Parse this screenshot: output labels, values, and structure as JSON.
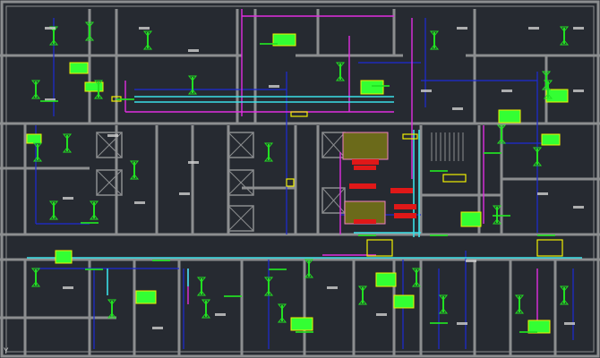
{
  "drawing": {
    "type": "HVAC floor plan (CAD)",
    "ucs_label": "Y"
  },
  "colors": {
    "background": "#262a31",
    "walls": "#8c8e90",
    "supply_duct": "#3ae0e8",
    "return_line": "#1d2bd6",
    "exhaust_line": "#e02ee0",
    "diffuser": "#22e022",
    "tag": "#f0f000",
    "equipment": "#e01818",
    "label_box": "#33ff33",
    "room_text": "#d0d0d0"
  }
}
